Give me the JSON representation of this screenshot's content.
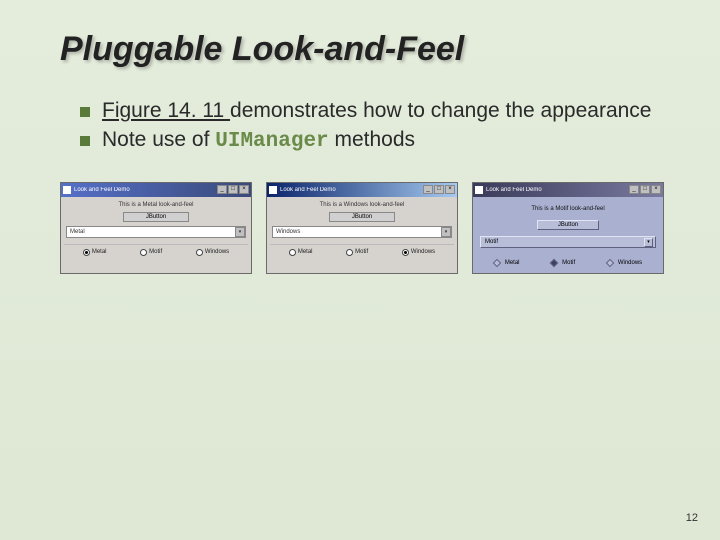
{
  "title": "Pluggable Look-and-Feel",
  "bullets": [
    {
      "link": "Figure 14. 11 ",
      "rest": "demonstrates how to change the appearance"
    },
    {
      "pre": "Note use of ",
      "code": "UIManager",
      "post": " methods"
    }
  ],
  "windows": {
    "metal": {
      "title": "Look and Feel Demo",
      "msg": "This is a Metal look-and-feel",
      "button": "JButton",
      "combo": "Metal",
      "radios": [
        "Metal",
        "Motif",
        "Windows"
      ],
      "selected": "Metal"
    },
    "win": {
      "title": "Look and Feel Demo",
      "msg": "This is a Windows look-and-feel",
      "button": "JButton",
      "combo": "Windows",
      "radios": [
        "Metal",
        "Motif",
        "Windows"
      ],
      "selected": "Windows"
    },
    "motif": {
      "title": "Look and Feel Demo",
      "msg": "This is a Motif look-and-feel",
      "button": "JButton",
      "combo": "Motif",
      "radios": [
        "Metal",
        "Motif",
        "Windows"
      ],
      "selected": "Motif"
    }
  },
  "page_number": "12"
}
